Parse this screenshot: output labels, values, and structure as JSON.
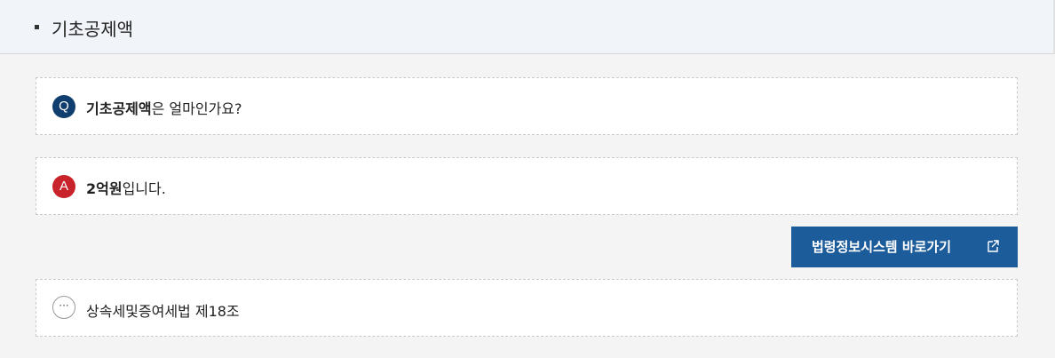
{
  "header": {
    "title": "기초공제액"
  },
  "question": {
    "badge": "Q",
    "bold": "기초공제액",
    "rest": "은 얼마인가요?"
  },
  "answer": {
    "badge": "A",
    "bold": "2억원",
    "rest": "입니다."
  },
  "link_button": {
    "label": "법령정보시스템 바로가기",
    "icon": "external-link-icon"
  },
  "law": {
    "icon": "more-dots-icon",
    "dots": "···",
    "text": "상속세및증여세법 제18조"
  },
  "colors": {
    "question_badge": "#103e6e",
    "answer_badge": "#c8222a",
    "button": "#1d5c9a"
  }
}
